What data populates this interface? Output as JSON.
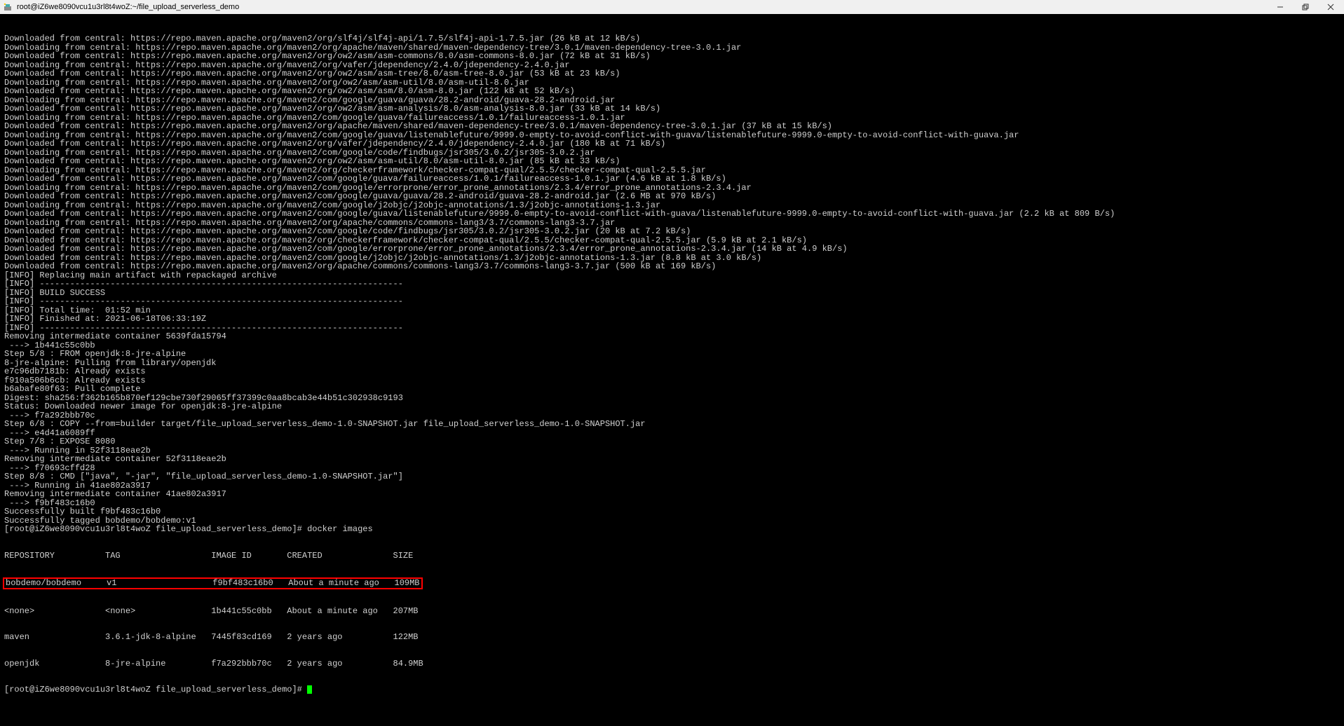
{
  "titlebar": {
    "title": "root@iZ6we8090vcu1u3rl8t4woZ:~/file_upload_serverless_demo"
  },
  "lines": [
    "Downloaded from central: https://repo.maven.apache.org/maven2/org/slf4j/slf4j-api/1.7.5/slf4j-api-1.7.5.jar (26 kB at 12 kB/s)",
    "Downloading from central: https://repo.maven.apache.org/maven2/org/apache/maven/shared/maven-dependency-tree/3.0.1/maven-dependency-tree-3.0.1.jar",
    "Downloaded from central: https://repo.maven.apache.org/maven2/org/ow2/asm/asm-commons/8.0/asm-commons-8.0.jar (72 kB at 31 kB/s)",
    "Downloading from central: https://repo.maven.apache.org/maven2/org/vafer/jdependency/2.4.0/jdependency-2.4.0.jar",
    "Downloaded from central: https://repo.maven.apache.org/maven2/org/ow2/asm/asm-tree/8.0/asm-tree-8.0.jar (53 kB at 23 kB/s)",
    "Downloading from central: https://repo.maven.apache.org/maven2/org/ow2/asm/asm-util/8.0/asm-util-8.0.jar",
    "Downloaded from central: https://repo.maven.apache.org/maven2/org/ow2/asm/asm/8.0/asm-8.0.jar (122 kB at 52 kB/s)",
    "Downloading from central: https://repo.maven.apache.org/maven2/com/google/guava/guava/28.2-android/guava-28.2-android.jar",
    "Downloaded from central: https://repo.maven.apache.org/maven2/org/ow2/asm/asm-analysis/8.0/asm-analysis-8.0.jar (33 kB at 14 kB/s)",
    "Downloading from central: https://repo.maven.apache.org/maven2/com/google/guava/failureaccess/1.0.1/failureaccess-1.0.1.jar",
    "Downloaded from central: https://repo.maven.apache.org/maven2/org/apache/maven/shared/maven-dependency-tree/3.0.1/maven-dependency-tree-3.0.1.jar (37 kB at 15 kB/s)",
    "Downloading from central: https://repo.maven.apache.org/maven2/com/google/guava/listenablefuture/9999.0-empty-to-avoid-conflict-with-guava/listenablefuture-9999.0-empty-to-avoid-conflict-with-guava.jar",
    "Downloaded from central: https://repo.maven.apache.org/maven2/org/vafer/jdependency/2.4.0/jdependency-2.4.0.jar (180 kB at 71 kB/s)",
    "Downloading from central: https://repo.maven.apache.org/maven2/com/google/code/findbugs/jsr305/3.0.2/jsr305-3.0.2.jar",
    "Downloaded from central: https://repo.maven.apache.org/maven2/org/ow2/asm/asm-util/8.0/asm-util-8.0.jar (85 kB at 33 kB/s)",
    "Downloading from central: https://repo.maven.apache.org/maven2/org/checkerframework/checker-compat-qual/2.5.5/checker-compat-qual-2.5.5.jar",
    "Downloaded from central: https://repo.maven.apache.org/maven2/com/google/guava/failureaccess/1.0.1/failureaccess-1.0.1.jar (4.6 kB at 1.8 kB/s)",
    "Downloading from central: https://repo.maven.apache.org/maven2/com/google/errorprone/error_prone_annotations/2.3.4/error_prone_annotations-2.3.4.jar",
    "Downloaded from central: https://repo.maven.apache.org/maven2/com/google/guava/guava/28.2-android/guava-28.2-android.jar (2.6 MB at 970 kB/s)",
    "Downloading from central: https://repo.maven.apache.org/maven2/com/google/j2objc/j2objc-annotations/1.3/j2objc-annotations-1.3.jar",
    "Downloaded from central: https://repo.maven.apache.org/maven2/com/google/guava/listenablefuture/9999.0-empty-to-avoid-conflict-with-guava/listenablefuture-9999.0-empty-to-avoid-conflict-with-guava.jar (2.2 kB at 809 B/s)",
    "Downloading from central: https://repo.maven.apache.org/maven2/org/apache/commons/commons-lang3/3.7/commons-lang3-3.7.jar",
    "Downloaded from central: https://repo.maven.apache.org/maven2/com/google/code/findbugs/jsr305/3.0.2/jsr305-3.0.2.jar (20 kB at 7.2 kB/s)",
    "Downloaded from central: https://repo.maven.apache.org/maven2/org/checkerframework/checker-compat-qual/2.5.5/checker-compat-qual-2.5.5.jar (5.9 kB at 2.1 kB/s)",
    "Downloaded from central: https://repo.maven.apache.org/maven2/com/google/errorprone/error_prone_annotations/2.3.4/error_prone_annotations-2.3.4.jar (14 kB at 4.9 kB/s)",
    "Downloaded from central: https://repo.maven.apache.org/maven2/com/google/j2objc/j2objc-annotations/1.3/j2objc-annotations-1.3.jar (8.8 kB at 3.0 kB/s)",
    "Downloaded from central: https://repo.maven.apache.org/maven2/org/apache/commons/commons-lang3/3.7/commons-lang3-3.7.jar (500 kB at 169 kB/s)",
    "[INFO] Replacing main artifact with repackaged archive",
    "[INFO] ------------------------------------------------------------------------",
    "[INFO] BUILD SUCCESS",
    "[INFO] ------------------------------------------------------------------------",
    "[INFO] Total time:  01:52 min",
    "[INFO] Finished at: 2021-06-18T06:33:19Z",
    "[INFO] ------------------------------------------------------------------------",
    "Removing intermediate container 5639fda15794",
    " ---> 1b441c55c0bb",
    "Step 5/8 : FROM openjdk:8-jre-alpine",
    "8-jre-alpine: Pulling from library/openjdk",
    "e7c96db7181b: Already exists",
    "f910a506b6cb: Already exists",
    "b6abafe80f63: Pull complete",
    "Digest: sha256:f362b165b870ef129cbe730f29065ff37399c0aa8bcab3e44b51c302938c9193",
    "Status: Downloaded newer image for openjdk:8-jre-alpine",
    " ---> f7a292bbb70c",
    "Step 6/8 : COPY --from=builder target/file_upload_serverless_demo-1.0-SNAPSHOT.jar file_upload_serverless_demo-1.0-SNAPSHOT.jar",
    " ---> e4d41a6089ff",
    "Step 7/8 : EXPOSE 8080",
    " ---> Running in 52f3118eae2b",
    "Removing intermediate container 52f3118eae2b",
    " ---> f70693cffd28",
    "Step 8/8 : CMD [\"java\", \"-jar\", \"file_upload_serverless_demo-1.0-SNAPSHOT.jar\"]",
    " ---> Running in 41ae802a3917",
    "Removing intermediate container 41ae802a3917",
    " ---> f9bf483c16b0",
    "Successfully built f9bf483c16b0",
    "Successfully tagged bobdemo/bobdemo:v1",
    "[root@iZ6we8090vcu1u3rl8t4woZ file_upload_serverless_demo]# docker images"
  ],
  "docker_header": "REPOSITORY          TAG                  IMAGE ID       CREATED              SIZE",
  "docker_rows": [
    "bobdemo/bobdemo     v1                   f9bf483c16b0   About a minute ago   109MB",
    "<none>              <none>               1b441c55c0bb   About a minute ago   207MB",
    "maven               3.6.1-jdk-8-alpine   7445f83cd169   2 years ago          122MB",
    "openjdk             8-jre-alpine         f7a292bbb70c   2 years ago          84.9MB"
  ],
  "prompt_line": "[root@iZ6we8090vcu1u3rl8t4woZ file_upload_serverless_demo]# "
}
